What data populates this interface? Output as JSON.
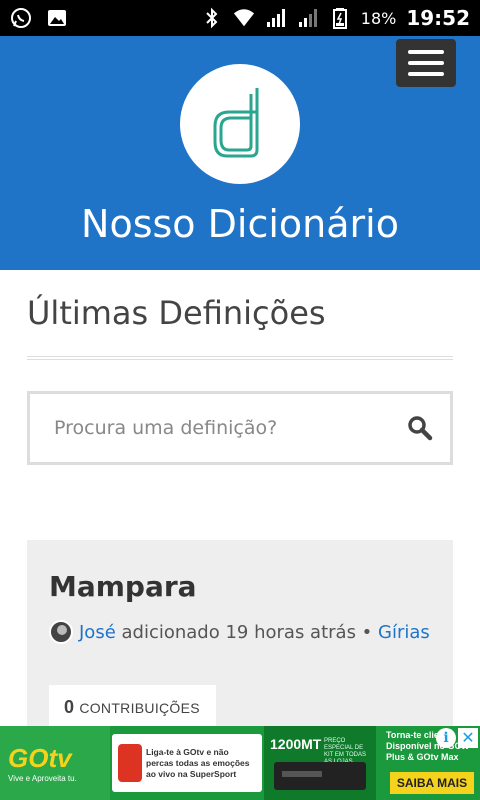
{
  "status_bar": {
    "battery_percent": "18%",
    "time": "19:52",
    "left_icons": [
      "whatsapp-icon",
      "image-icon"
    ],
    "right_icons": [
      "bluetooth-icon",
      "wifi-icon",
      "signal-icon",
      "signal-2-icon",
      "battery-icon"
    ]
  },
  "header": {
    "site_title": "Nosso Dicionário",
    "logo_letter": "d",
    "brand_color": "#1f74c8"
  },
  "main": {
    "section_title": "Últimas Definições",
    "search": {
      "placeholder": "Procura uma definição?"
    },
    "entry": {
      "title": "Mampara",
      "author": "José",
      "added_text": " adicionado 19 horas atrás • ",
      "category": "Gírias",
      "contributions_count": "0",
      "contributions_label": "CONTRIBUIÇÕES"
    }
  },
  "ad": {
    "brand": "GOtv",
    "brand_sub": "Vive e Aproveita tu.",
    "promo_text": "Liga-te à GOtv e não percas todas as emoções ao vivo na SuperSport",
    "price": "1200MT",
    "price_note": "PREÇO ESPECIAL DE KIT EM TODAS AS LOJAS",
    "right_text": "Torna-te cliente Disponível no GOtv Plus & GOtv Max",
    "cta": "SAIBA MAIS"
  }
}
